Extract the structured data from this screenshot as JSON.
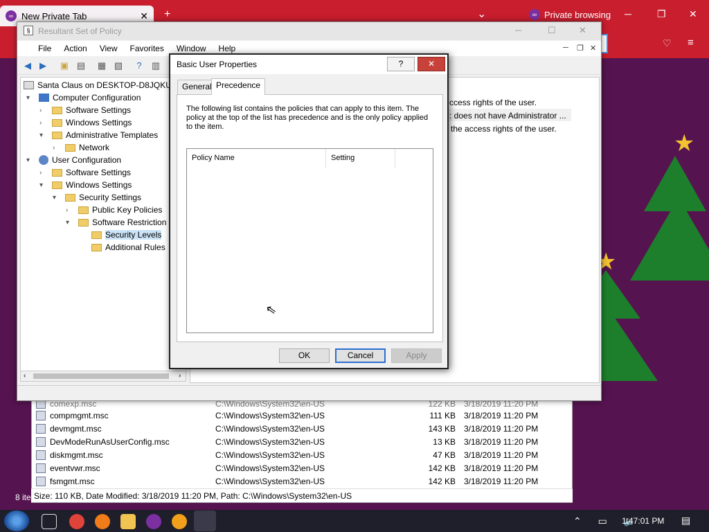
{
  "browser": {
    "tab_title": "New Private Tab",
    "tab_close": "✕",
    "new_tab": "+",
    "private_label": "Private browsing",
    "tabs_menu": "⌄",
    "min": "─",
    "max": "❐",
    "close": "✕"
  },
  "rsop": {
    "title": "Resultant Set of Policy",
    "menu": [
      "File",
      "Action",
      "View",
      "Favorites",
      "Window",
      "Help"
    ],
    "tree": [
      {
        "label": "Santa Claus on DESKTOP-D8JQKUA - ",
        "depth": 0,
        "expander": "",
        "icon": "policy"
      },
      {
        "label": "Computer Configuration",
        "depth": 0,
        "expander": "▾",
        "icon": "pc"
      },
      {
        "label": "Software Settings",
        "depth": 1,
        "expander": "›",
        "icon": "folder"
      },
      {
        "label": "Windows Settings",
        "depth": 1,
        "expander": "›",
        "icon": "folder"
      },
      {
        "label": "Administrative Templates",
        "depth": 1,
        "expander": "▾",
        "icon": "folder"
      },
      {
        "label": "Network",
        "depth": 2,
        "expander": "›",
        "icon": "folder"
      },
      {
        "label": "User Configuration",
        "depth": 0,
        "expander": "▾",
        "icon": "user"
      },
      {
        "label": "Software Settings",
        "depth": 1,
        "expander": "›",
        "icon": "folder"
      },
      {
        "label": "Windows Settings",
        "depth": 1,
        "expander": "▾",
        "icon": "folder"
      },
      {
        "label": "Security Settings",
        "depth": 2,
        "expander": "▾",
        "icon": "folder"
      },
      {
        "label": "Public Key Policies",
        "depth": 3,
        "expander": "›",
        "icon": "folder"
      },
      {
        "label": "Software Restriction P",
        "depth": 3,
        "expander": "▾",
        "icon": "folder"
      },
      {
        "label": "Security Levels",
        "depth": 4,
        "expander": "",
        "icon": "folder",
        "selected": true
      },
      {
        "label": "Additional Rules",
        "depth": 4,
        "expander": "",
        "icon": "folder"
      }
    ],
    "right_pane": {
      "line1": "ccess rights of the user.",
      "line2": ": does not have Administrator ...",
      "line3": "the access rights of the user."
    }
  },
  "dialog": {
    "title": "Basic User Properties",
    "help": "?",
    "close": "✕",
    "tabs": [
      "General",
      "Precedence"
    ],
    "description": "The following list contains the policies that can apply to this item.  The policy at the top of the list has precedence and is the only policy applied to the item.",
    "columns": [
      "Policy Name",
      "Setting"
    ],
    "ok": "OK",
    "cancel": "Cancel",
    "apply": "Apply"
  },
  "explorer": {
    "partial_row": {
      "name": "comexp.msc",
      "path": "C:\\Windows\\System32\\en-US",
      "size": "122 KB",
      "date": "3/18/2019 11:20 PM"
    },
    "rows": [
      {
        "name": "compmgmt.msc",
        "path": "C:\\Windows\\System32\\en-US",
        "size": "111 KB",
        "date": "3/18/2019 11:20 PM"
      },
      {
        "name": "devmgmt.msc",
        "path": "C:\\Windows\\System32\\en-US",
        "size": "143 KB",
        "date": "3/18/2019 11:20 PM"
      },
      {
        "name": "DevModeRunAsUserConfig.msc",
        "path": "C:\\Windows\\System32\\en-US",
        "size": "13 KB",
        "date": "3/18/2019 11:20 PM"
      },
      {
        "name": "diskmgmt.msc",
        "path": "C:\\Windows\\System32\\en-US",
        "size": "47 KB",
        "date": "3/18/2019 11:20 PM"
      },
      {
        "name": "eventvwr.msc",
        "path": "C:\\Windows\\System32\\en-US",
        "size": "142 KB",
        "date": "3/18/2019 11:20 PM"
      },
      {
        "name": "fsmgmt.msc",
        "path": "C:\\Windows\\System32\\en-US",
        "size": "142 KB",
        "date": "3/18/2019 11:20 PM"
      }
    ],
    "status": "Size: 110 KB, Date Modified: 3/18/2019 11:20 PM, Path: C:\\Windows\\System32\\en-US",
    "items_count": "8 ite"
  },
  "taskbar": {
    "clock": "1:47:01 PM",
    "tray": "⌃ ▭ 🔈",
    "notifications": "▤"
  },
  "colors": {
    "browser_red": "#c81e2e",
    "desktop_purple": "#55134f",
    "close_red": "#c7423a"
  }
}
